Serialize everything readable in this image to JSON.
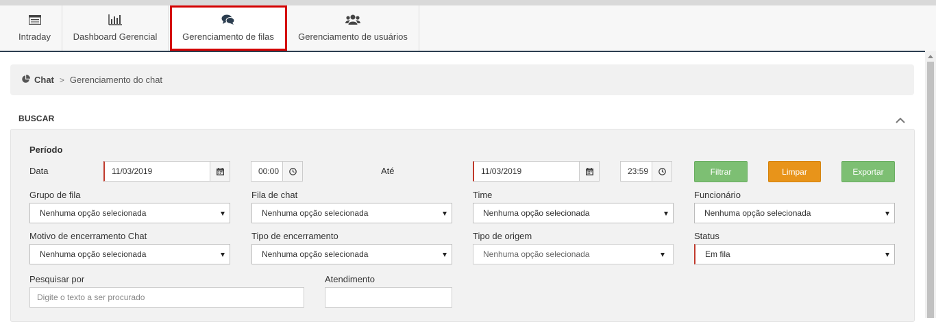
{
  "tabs": [
    {
      "label": "Intraday",
      "icon": "list-icon"
    },
    {
      "label": "Dashboard Gerencial",
      "icon": "bar-chart-icon"
    },
    {
      "label": "Gerenciamento de filas",
      "icon": "chat-bubbles-icon",
      "active": true
    },
    {
      "label": "Gerenciamento de usuários",
      "icon": "users-icon"
    }
  ],
  "breadcrumb": {
    "root": "Chat",
    "separator": ">",
    "current": "Gerenciamento do chat"
  },
  "section": {
    "title": "BUSCAR"
  },
  "filters": {
    "period_label": "Período",
    "date_label": "Data",
    "date_from": "11/03/2019",
    "time_from": "00:00",
    "until_label": "Até",
    "date_to": "11/03/2019",
    "time_to": "23:59",
    "buttons": {
      "filter": "Filtrar",
      "clear": "Limpar",
      "export": "Exportar"
    },
    "row1": [
      {
        "label": "Grupo de fila",
        "value": "Nenhuma opção selecionada"
      },
      {
        "label": "Fila de chat",
        "value": "Nenhuma opção selecionada"
      },
      {
        "label": "Time",
        "value": "Nenhuma opção selecionada"
      },
      {
        "label": "Funcionário",
        "value": "Nenhuma opção selecionada"
      }
    ],
    "row2": [
      {
        "label": "Motivo de encerramento Chat",
        "value": "Nenhuma opção selecionada"
      },
      {
        "label": "Tipo de encerramento",
        "value": "Nenhuma opção selecionada"
      },
      {
        "label": "Tipo de origem",
        "value": "Nenhuma opção selecionada"
      },
      {
        "label": "Status",
        "value": "Em fila"
      }
    ],
    "search_label": "Pesquisar por",
    "search_placeholder": "Digite o texto a ser procurado",
    "attendance_label": "Atendimento",
    "attendance_value": ""
  },
  "colors": {
    "filter": "#7dbf73",
    "clear": "#e8941a",
    "export": "#7dbf73",
    "active_outline": "#d40000",
    "required": "#c0392b"
  }
}
